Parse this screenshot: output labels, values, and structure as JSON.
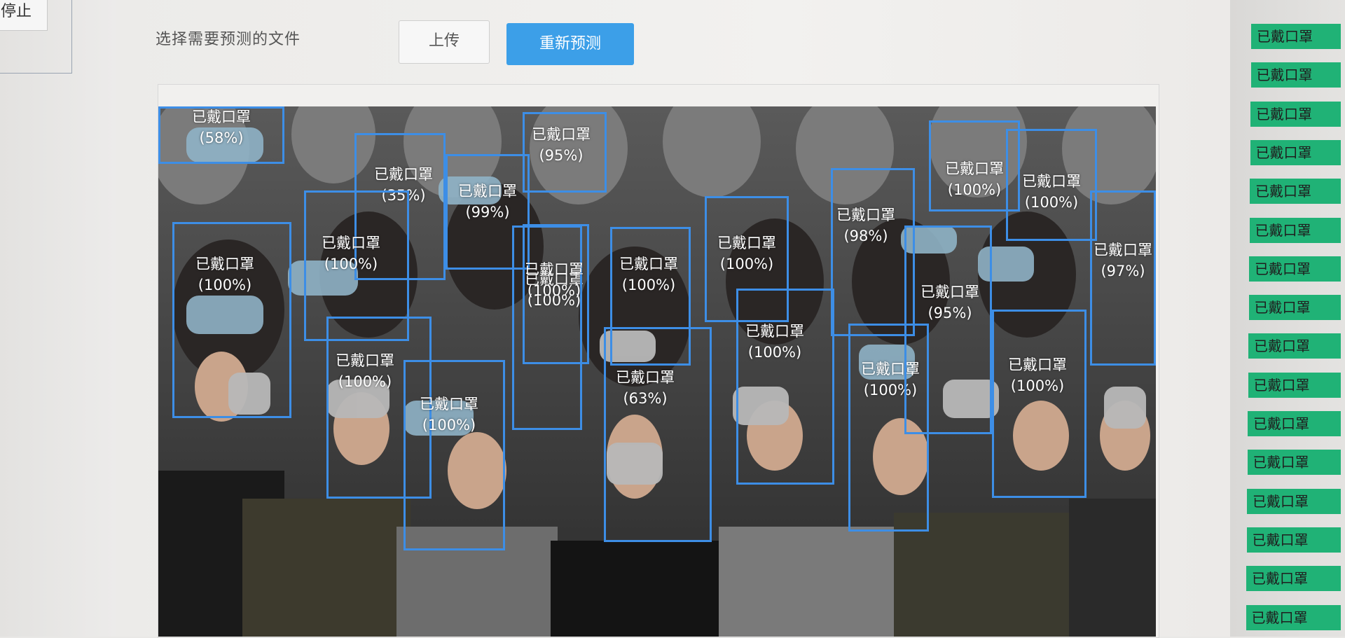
{
  "left": {
    "stop_label": "停止"
  },
  "toolbar": {
    "file_prompt": "选择需要预测的文件",
    "upload_label": "上传",
    "repredict_label": "重新预测"
  },
  "detections": [
    {
      "label": "已戴口罩",
      "confidence": "(58%)"
    },
    {
      "label": "已戴口罩",
      "confidence": "(35%)"
    },
    {
      "label": "已戴口罩",
      "confidence": "(95%)"
    },
    {
      "label": "已戴口罩",
      "confidence": "(99%)"
    },
    {
      "label": "已戴口罩",
      "confidence": "(100%)"
    },
    {
      "label": "已戴口罩",
      "confidence": "(100%)"
    },
    {
      "label": "已戴口罩",
      "confidence": "(100%)"
    },
    {
      "label": "已戴口罩",
      "confidence": "(100%)"
    },
    {
      "label": "已戴口罩",
      "confidence": "(100%)"
    },
    {
      "label": "已戴口罩",
      "confidence": "(98%)"
    },
    {
      "label": "已戴口罩",
      "confidence": "(100%)"
    },
    {
      "label": "已戴口罩",
      "confidence": "(100%)"
    },
    {
      "label": "已戴口罩",
      "confidence": "(97%)"
    },
    {
      "label": "已戴口罩",
      "confidence": "(100%)"
    },
    {
      "label": "已戴口罩",
      "confidence": "(100%)"
    },
    {
      "label": "已戴口罩",
      "confidence": "(100%)"
    },
    {
      "label": "已戴口罩",
      "confidence": "(63%)"
    },
    {
      "label": "已戴口罩",
      "confidence": "(100%)"
    },
    {
      "label": "已戴口罩",
      "confidence": "(100%)"
    },
    {
      "label": "已戴口罩",
      "confidence": "(95%)"
    },
    {
      "label": "已戴口罩",
      "confidence": "(100%)"
    }
  ],
  "results": [
    "已戴口罩",
    "已戴口罩",
    "已戴口罩",
    "已戴口罩",
    "已戴口罩",
    "已戴口罩",
    "已戴口罩",
    "已戴口罩",
    "已戴口罩",
    "已戴口罩",
    "已戴口罩",
    "已戴口罩",
    "已戴口罩",
    "已戴口罩",
    "已戴口罩",
    "已戴口罩"
  ],
  "colors": {
    "primary_button": "#3c9fe8",
    "box_stroke": "#3d8ee6",
    "result_tag": "#20b276"
  }
}
